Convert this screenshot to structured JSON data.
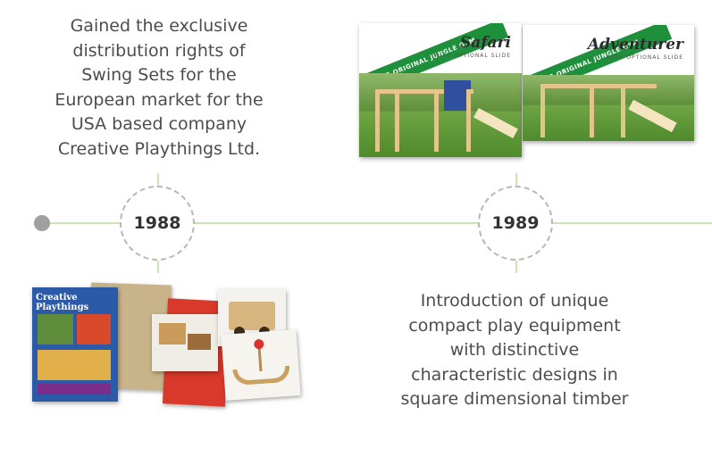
{
  "timeline": {
    "entries": [
      {
        "year": "1988",
        "text": "Gained the exclusive distribution rights of Swing Sets for the European market for the USA based company Creative Playthings Ltd."
      },
      {
        "year": "1989",
        "text": "Introduction of unique compact play equipment with distinctive characteristic designs in square dimensional timber"
      }
    ]
  },
  "images": {
    "safari": {
      "name": "Safari",
      "banner": "THE ORIGINAL JUNGLE GYM",
      "sub": "WITH OPTIONAL SLIDE"
    },
    "adventurer": {
      "name": "Adventurer",
      "banner": "THE ORIGINAL JUNGLE GYM",
      "sub": "WITH OPTIONAL SLIDE"
    },
    "catalog": {
      "title": "Creative Playthings"
    }
  }
}
